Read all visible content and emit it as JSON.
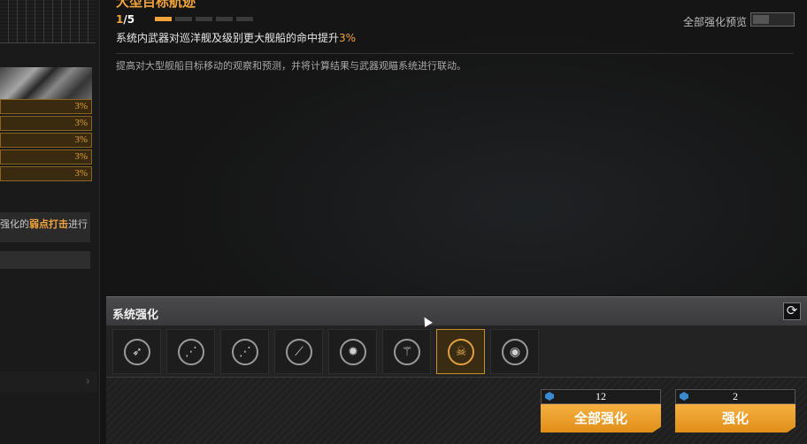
{
  "module": {
    "title": "大型目标航迹",
    "level_current": "1",
    "level_max": "/5",
    "level_pips": [
      1,
      0,
      0,
      0,
      0
    ],
    "effect_text": "系统内武器对巡洋舰及级别更大舰船的命中提升",
    "effect_value": "3%",
    "description": "提高对大型舰船目标移动的观察和预测，并将计算结果与武器观瞄系统进行联动。",
    "preview_label": "全部强化预览"
  },
  "left_panel": {
    "stat_values": [
      "3%",
      "3%",
      "3%",
      "3%",
      "3%"
    ],
    "desc_prefix": "强化的",
    "desc_highlight": "弱点打击",
    "desc_suffix": "进行"
  },
  "system_panel": {
    "title": "系统强化",
    "refresh_icon": "⟳",
    "slots": [
      {
        "icon": "➶",
        "icon_name": "missile-icon",
        "selected": false
      },
      {
        "icon": "⋰",
        "icon_name": "rockets-icon",
        "selected": false
      },
      {
        "icon": "⋰",
        "icon_name": "torpedo-icon",
        "selected": false
      },
      {
        "icon": "⟋",
        "icon_name": "shell-icon",
        "selected": false
      },
      {
        "icon": "✹",
        "icon_name": "burst-icon",
        "selected": false
      },
      {
        "icon": "⚚",
        "icon_name": "guitar-icon",
        "selected": false
      },
      {
        "icon": "☠",
        "icon_name": "lion-icon",
        "selected": true
      },
      {
        "icon": "◉",
        "icon_name": "radar-icon",
        "selected": false
      }
    ]
  },
  "buttons": {
    "upgrade_all": {
      "cost": "12",
      "label": "全部强化"
    },
    "upgrade": {
      "cost": "2",
      "label": "强化"
    }
  },
  "colors": {
    "accent": "#f2a43a",
    "button": "#e8961f"
  }
}
